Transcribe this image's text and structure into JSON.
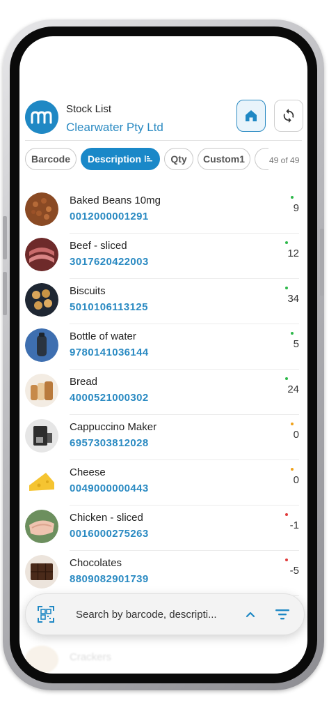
{
  "header": {
    "title": "Stock List",
    "company": "Clearwater Pty Ltd",
    "home_icon": "home-icon",
    "sync_icon": "sync-icon"
  },
  "tabs": [
    {
      "label": "Barcode",
      "active": false
    },
    {
      "label": "Description",
      "active": true,
      "sort_icon": "sort-ascending-icon"
    },
    {
      "label": "Qty",
      "active": false
    },
    {
      "label": "Custom1",
      "active": false
    }
  ],
  "count": "49 of 49",
  "items": [
    {
      "name": "Baked Beans 10mg",
      "code": "0012000001291",
      "qty": "9",
      "status": "green"
    },
    {
      "name": "Beef - sliced",
      "code": "3017620422003",
      "qty": "12",
      "status": "green"
    },
    {
      "name": "Biscuits",
      "code": "5010106113125",
      "qty": "34",
      "status": "green"
    },
    {
      "name": "Bottle of water",
      "code": "9780141036144",
      "qty": "5",
      "status": "green"
    },
    {
      "name": "Bread",
      "code": "4000521000302",
      "qty": "24",
      "status": "green"
    },
    {
      "name": "Cappuccino Maker",
      "code": "6957303812028",
      "qty": "0",
      "status": "orange"
    },
    {
      "name": "Cheese",
      "code": "0049000000443",
      "qty": "0",
      "status": "orange"
    },
    {
      "name": "Chicken - sliced",
      "code": "0016000275263",
      "qty": "-1",
      "status": "red"
    },
    {
      "name": "Chocolates",
      "code": "8809082901739",
      "qty": "-5",
      "status": "red"
    }
  ],
  "ghost_item": "Crackers",
  "search": {
    "placeholder": "Search by barcode, descripti..."
  },
  "colors": {
    "accent": "#2a8ac2",
    "green": "#2db84a",
    "orange": "#f0a21a",
    "red": "#e03a3a"
  }
}
